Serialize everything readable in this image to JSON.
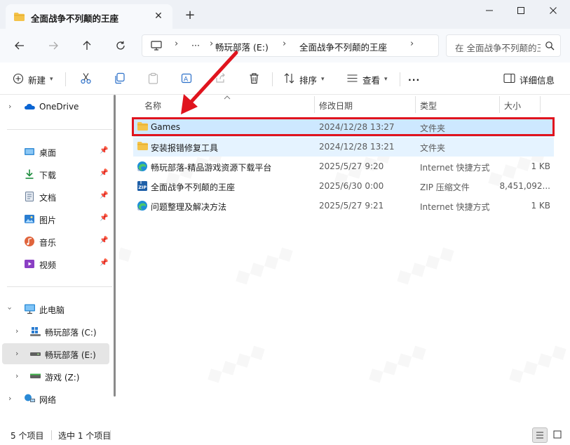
{
  "window": {
    "tab_title": "全面战争不列颠的王座",
    "new_tab": "+",
    "close_tab": "✕"
  },
  "address": {
    "segments": [
      "畅玩部落 (E:)",
      "全面战争不列颠的王座"
    ],
    "ellipsis": "···",
    "search_placeholder": "在 全面战争不列颠的王座 中搜索"
  },
  "commands": {
    "new": "新建",
    "sort": "排序",
    "view": "查看",
    "more": "···",
    "details": "详细信息"
  },
  "sidebar": {
    "onedrive": "OneDrive",
    "quick": [
      {
        "label": "桌面",
        "icon": "desktop-icon"
      },
      {
        "label": "下载",
        "icon": "download-icon"
      },
      {
        "label": "文档",
        "icon": "document-icon"
      },
      {
        "label": "图片",
        "icon": "pictures-icon"
      },
      {
        "label": "音乐",
        "icon": "music-icon"
      },
      {
        "label": "视频",
        "icon": "video-icon"
      }
    ],
    "this_pc": "此电脑",
    "drives": [
      {
        "label": "畅玩部落 (C:)"
      },
      {
        "label": "畅玩部落 (E:)"
      },
      {
        "label": "游戏 (Z:)"
      }
    ],
    "network": "网络"
  },
  "columns": {
    "name": "名称",
    "modified": "修改日期",
    "type": "类型",
    "size": "大小"
  },
  "files": [
    {
      "name": "Games",
      "modified": "2024/12/28 13:27",
      "type": "文件夹",
      "size": "",
      "icon": "folder-icon"
    },
    {
      "name": "安装报错修复工具",
      "modified": "2024/12/28 13:21",
      "type": "文件夹",
      "size": "",
      "icon": "folder-icon"
    },
    {
      "name": "畅玩部落-精品游戏资源下载平台",
      "modified": "2025/5/27 9:20",
      "type": "Internet 快捷方式",
      "size": "1 KB",
      "icon": "edge-shortcut-icon"
    },
    {
      "name": "全面战争不列颠的王座",
      "modified": "2025/6/30 0:00",
      "type": "ZIP 压缩文件",
      "size": "8,451,092...",
      "icon": "zip-icon"
    },
    {
      "name": "问题整理及解决方法",
      "modified": "2025/5/27 9:21",
      "type": "Internet 快捷方式",
      "size": "1 KB",
      "icon": "edge-shortcut-icon"
    }
  ],
  "status": {
    "count": "5 个项目",
    "selected": "选中 1 个项目"
  },
  "colors": {
    "highlight": "#e0141e",
    "selection": "#cde8ff",
    "folder": "#f4c34a"
  }
}
